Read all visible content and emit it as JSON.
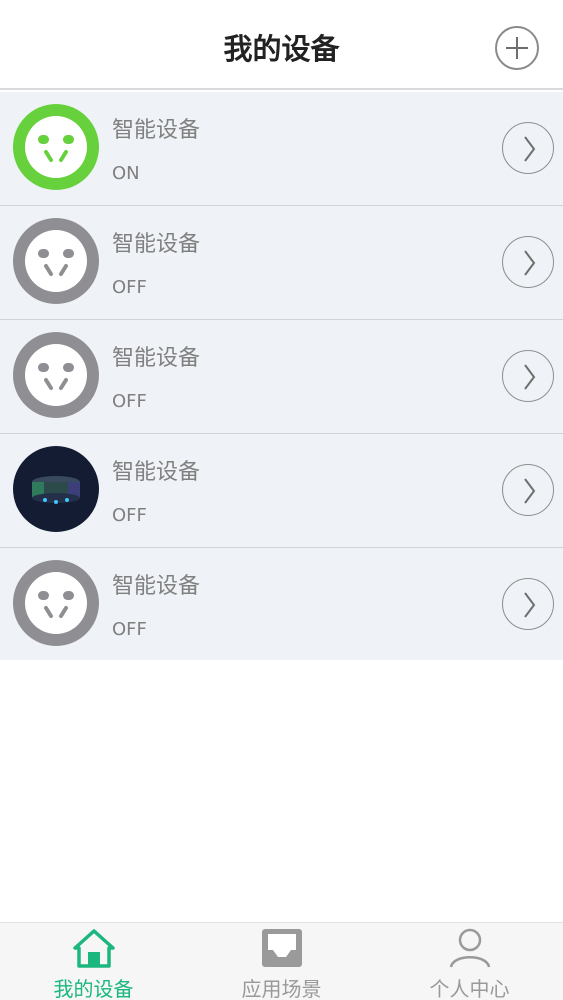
{
  "header": {
    "title": "我的设备",
    "add_icon": "plus-circle-icon"
  },
  "devices": [
    {
      "name": "智能设备",
      "status": "ON",
      "icon": "smart-plug-on-icon",
      "accent": "#66d13d"
    },
    {
      "name": "智能设备",
      "status": "OFF",
      "icon": "smart-plug-off-icon",
      "accent": "#8e8e93"
    },
    {
      "name": "智能设备",
      "status": "OFF",
      "icon": "smart-plug-off-icon",
      "accent": "#8e8e93"
    },
    {
      "name": "智能设备",
      "status": "OFF",
      "icon": "smart-lamp-icon",
      "accent": "#1a2440"
    },
    {
      "name": "智能设备",
      "status": "OFF",
      "icon": "smart-plug-off-icon",
      "accent": "#8e8e93"
    }
  ],
  "tabbar": {
    "tabs": [
      {
        "label": "我的设备",
        "icon": "home-icon",
        "active": true
      },
      {
        "label": "应用场景",
        "icon": "scene-icon",
        "active": false
      },
      {
        "label": "个人中心",
        "icon": "person-icon",
        "active": false
      }
    ],
    "active_color": "#1bb77e"
  }
}
